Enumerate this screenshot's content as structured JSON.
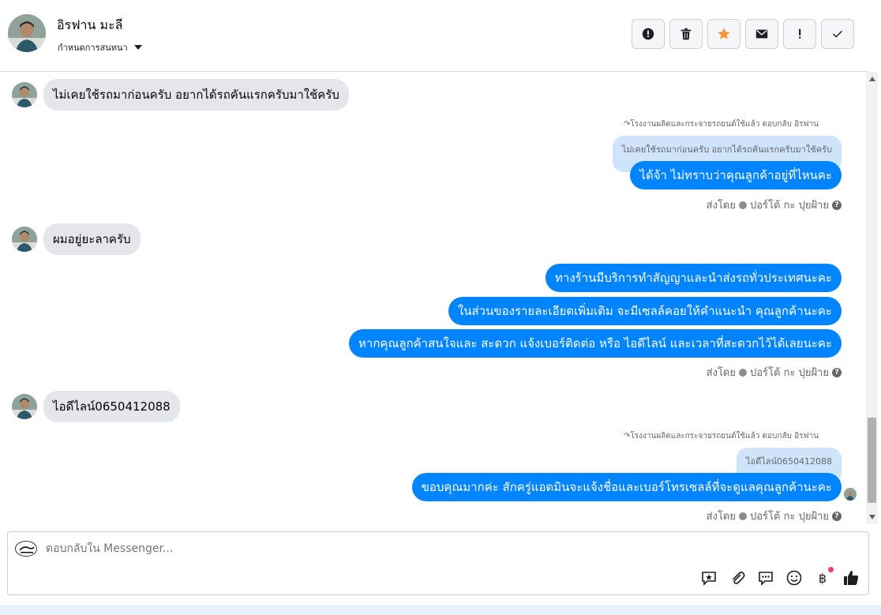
{
  "header": {
    "contact_name": "อิรฟาน มะลี",
    "assign_label": "กำหนดการสนทนา",
    "actions": [
      {
        "name": "mark-spam-button",
        "icon": "alert-circle-icon"
      },
      {
        "name": "delete-button",
        "icon": "trash-icon"
      },
      {
        "name": "star-button",
        "icon": "star-icon"
      },
      {
        "name": "mark-unread-button",
        "icon": "envelope-icon"
      },
      {
        "name": "follow-up-button",
        "icon": "exclamation-icon"
      },
      {
        "name": "mark-done-button",
        "icon": "check-icon"
      }
    ]
  },
  "messages": {
    "in1": "ไม่เคยใช้รถมาก่อนครับ  อยากได้รถคันแรกครับมาใช้ครับ",
    "reply1_note": "โรงงานผลิตและกระจายรถยนต์ใช้แล้ว ตอบกลับ อิรฟาน",
    "reply1_quote": "ไม่เคยใช้รถมาก่อนครับ อยากได้รถคันแรกครับมาใช้ครับ",
    "out1": "ได้จ้า ไม่ทราบว่าคุณลูกค้าอยู่ที่ไหนคะ",
    "sent_by_label": "ส่งโดย",
    "sender_name": "ปอร์โต้ กะ ปุยฝ้าย",
    "in2": "ผมอยู่ยะลาครับ",
    "out2": "ทางร้านมีบริการทำสัญญาและนำส่งรถทั่วประเทศนะคะ",
    "out3": "ในส่วนของรายละเอียดเพิ่มเติม จะมีเซลล์คอยให้คำแนะนำ คุณลูกค้านะคะ",
    "out4": "หากคุณลูกค้าสนใจและ สะดวก แจ้งเบอร์ติดต่อ หรือ ไอดีไลน์ และเวลาที่สะดวกไว้ได้เลยนะคะ",
    "in3": "ไอดีไลน์0650412088",
    "reply2_note": "โรงงานผลิตและกระจายรถยนต์ใช้แล้ว ตอบกลับ อิรฟาน",
    "reply2_quote": "ไอดีไลน์0650412088",
    "out5": "ขอบคุณมากค่ะ สักครู่แอดมินจะแจ้งชื่อและเบอร์โทรเซลล์ที่จะดูแลคุณลูกค้านะคะ"
  },
  "composer": {
    "placeholder": "ตอบกลับใน Messenger...",
    "tools": [
      "saved-reply-icon",
      "attachment-icon",
      "chat-icon",
      "emoji-icon",
      "baht-icon",
      "thumbs-up-icon"
    ]
  },
  "colors": {
    "outgoing_bubble": "#0084ff",
    "incoming_bubble": "#e4e6eb",
    "quoted_bubble": "#cfe3fb",
    "star": "#f7923a"
  }
}
